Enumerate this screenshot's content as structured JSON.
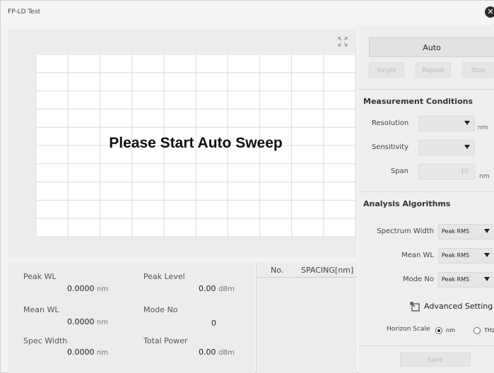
{
  "window": {
    "title": "FP-LD Test",
    "close_icon": "close-icon"
  },
  "graph": {
    "message": "Please Start Auto Sweep"
  },
  "results": {
    "peak_wl": {
      "label": "Peak WL",
      "value": "0.0000",
      "unit": "nm"
    },
    "mean_wl": {
      "label": "Mean WL",
      "value": "0.0000",
      "unit": "nm"
    },
    "spec_width": {
      "label": "Spec Width",
      "value": "0.0000",
      "unit": "nm"
    },
    "peak_level": {
      "label": "Peak Level",
      "value": "0.00",
      "unit": "dBm"
    },
    "mode_no": {
      "label": "Mode No",
      "value": "0"
    },
    "total_power": {
      "label": "Total Power",
      "value": "0.00",
      "unit": "dBm"
    }
  },
  "spacing_table": {
    "col_no": "No.",
    "col_spacing": "SPACING[nm]"
  },
  "sweep": {
    "auto_label": "Auto",
    "single_label": "Single",
    "repeat_label": "Repeat",
    "stop_label": "Stop"
  },
  "measurement": {
    "title": "Measurement Conditions",
    "resolution_label": "Resolution",
    "resolution_unit": "nm",
    "sensitivity_label": "Sensitivity",
    "span_label": "Span",
    "span_value": "10",
    "span_unit": "nm"
  },
  "analysis": {
    "title": "Analysis Algorithms",
    "spectrum_width_label": "Spectrum Width",
    "spectrum_width_value": "Peak RMS",
    "mean_wl_label": "Mean WL",
    "mean_wl_value": "Peak RMS",
    "mode_no_label": "Mode No",
    "mode_no_value": "Peak RMS",
    "advanced_label": "Advanced Setting",
    "horizon_scale_label": "Horizon Scale",
    "horizon_option_nm": "nm",
    "horizon_option_thz": "THz",
    "horizon_selected": "nm"
  },
  "save_label": "Save"
}
